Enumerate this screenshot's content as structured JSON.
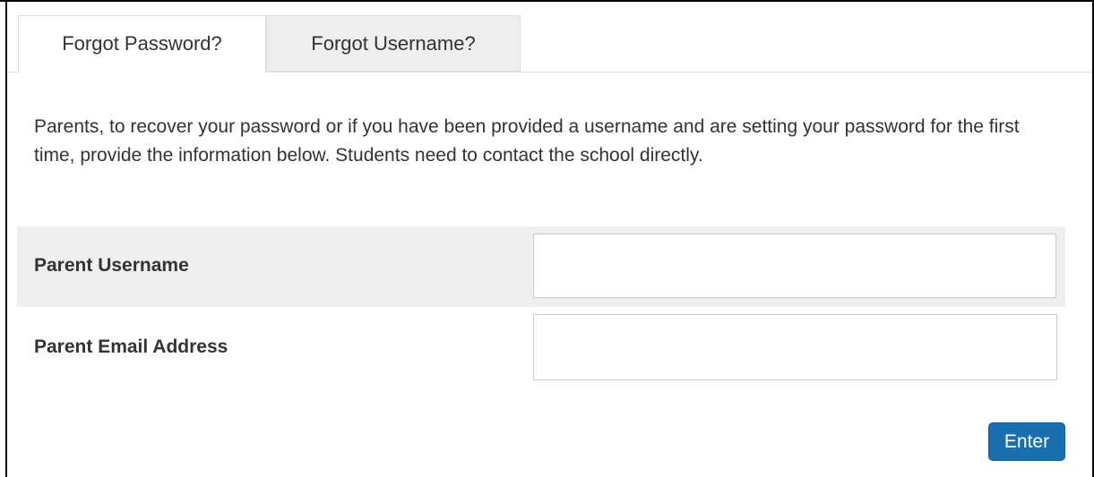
{
  "tabs": [
    {
      "label": "Forgot Password?",
      "active": true
    },
    {
      "label": "Forgot Username?",
      "active": false
    }
  ],
  "intro_text": "Parents, to recover your password or if you have been provided a username and are setting your password for the first time, provide the information below. Students need to contact the school directly.",
  "form": {
    "username_label": "Parent Username",
    "username_value": "",
    "email_label": "Parent Email Address",
    "email_value": ""
  },
  "enter_button_label": "Enter",
  "colors": {
    "accent": "#1a6fae",
    "active_row_background": "#efefef",
    "inactive_tab_background": "#eeeeee"
  }
}
